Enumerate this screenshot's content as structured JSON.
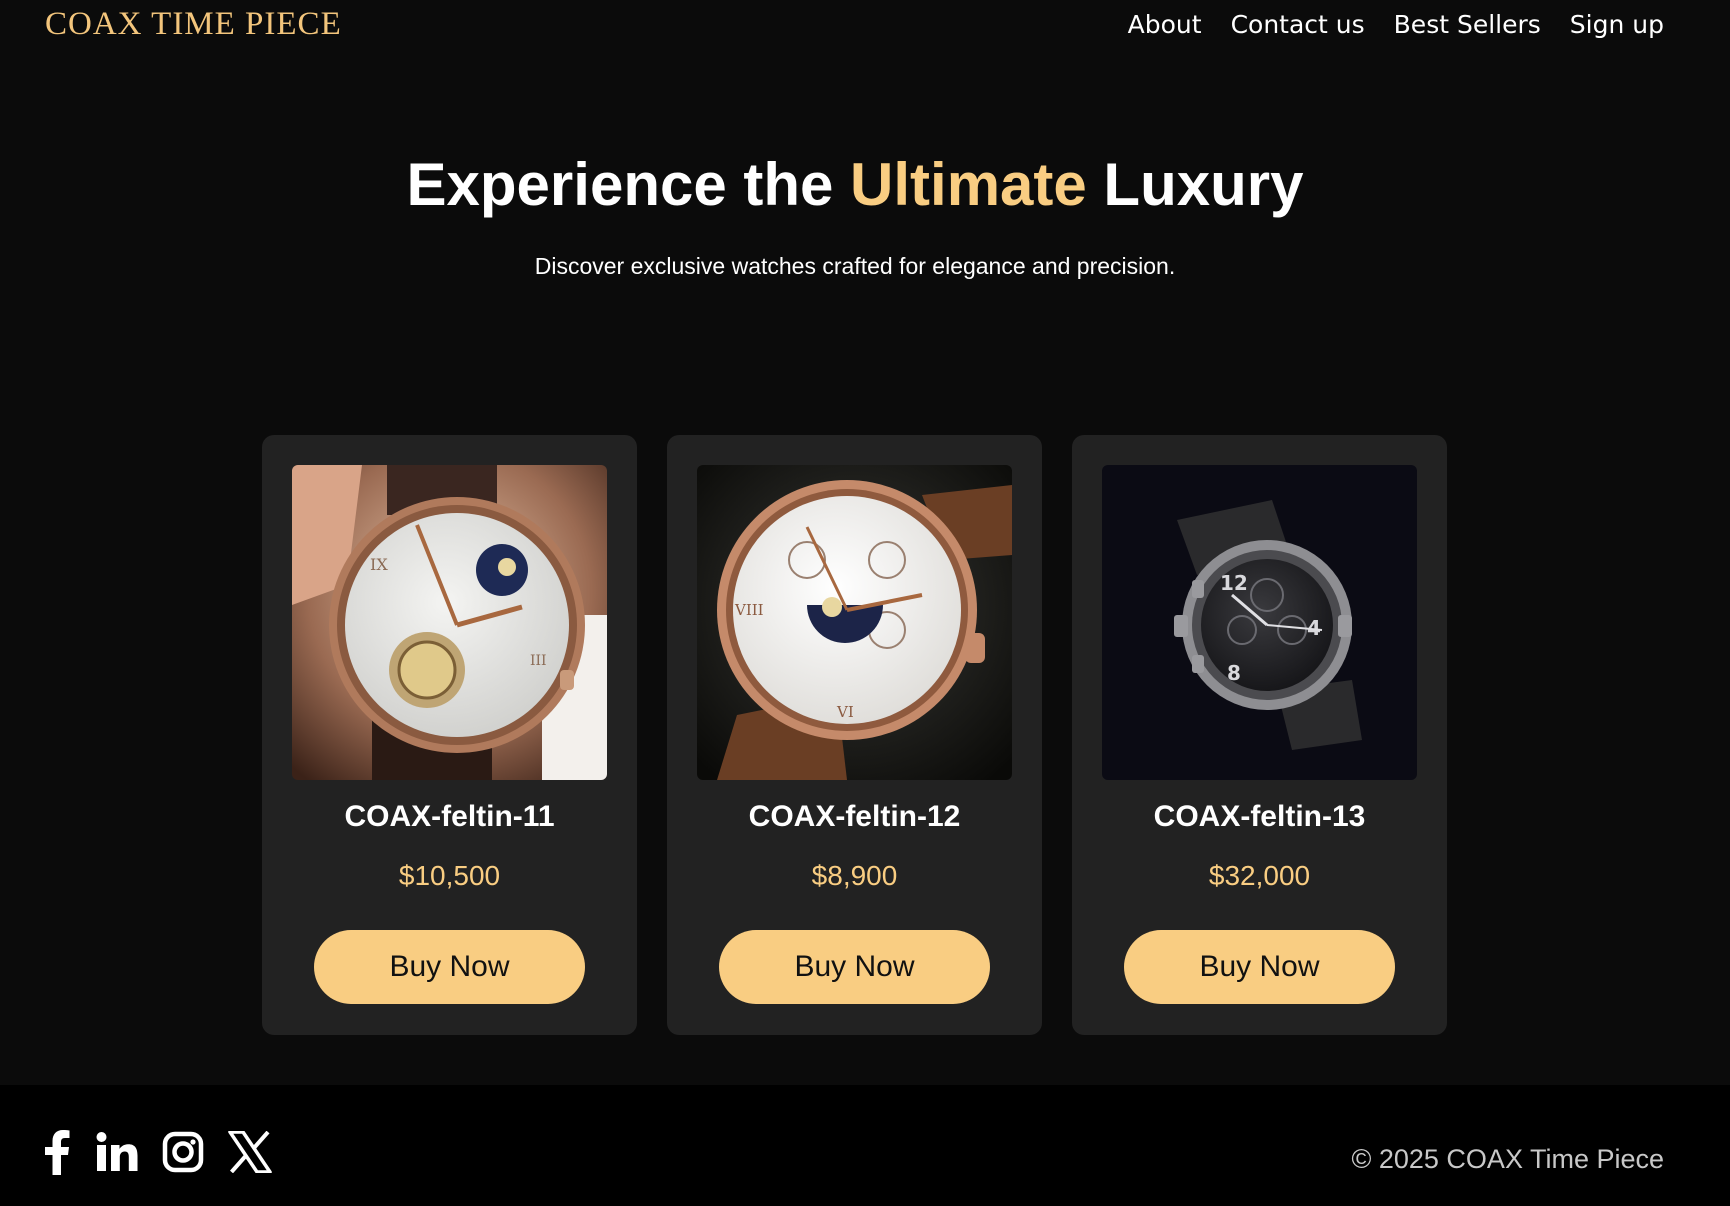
{
  "header": {
    "logo": "COAX TIME PIECE",
    "nav": [
      {
        "label": "About"
      },
      {
        "label": "Contact us"
      },
      {
        "label": "Best Sellers"
      },
      {
        "label": "Sign up"
      }
    ]
  },
  "hero": {
    "title_before": "Experience the ",
    "title_accent": "Ultimate",
    "title_after": " Luxury",
    "subtitle": "Discover exclusive watches crafted for elegance and precision."
  },
  "products": [
    {
      "name": "COAX-feltin-11",
      "price": "$10,500",
      "button": "Buy Now"
    },
    {
      "name": "COAX-feltin-12",
      "price": "$8,900",
      "button": "Buy Now"
    },
    {
      "name": "COAX-feltin-13",
      "price": "$32,000",
      "button": "Buy Now"
    }
  ],
  "footer": {
    "socials": [
      "facebook-icon",
      "linkedin-icon",
      "instagram-icon",
      "x-icon"
    ],
    "copyright": "© 2025 COAX Time Piece"
  },
  "colors": {
    "background": "#0b0b0b",
    "card": "#222222",
    "accent": "#f9cd82",
    "footer": "#000000"
  }
}
